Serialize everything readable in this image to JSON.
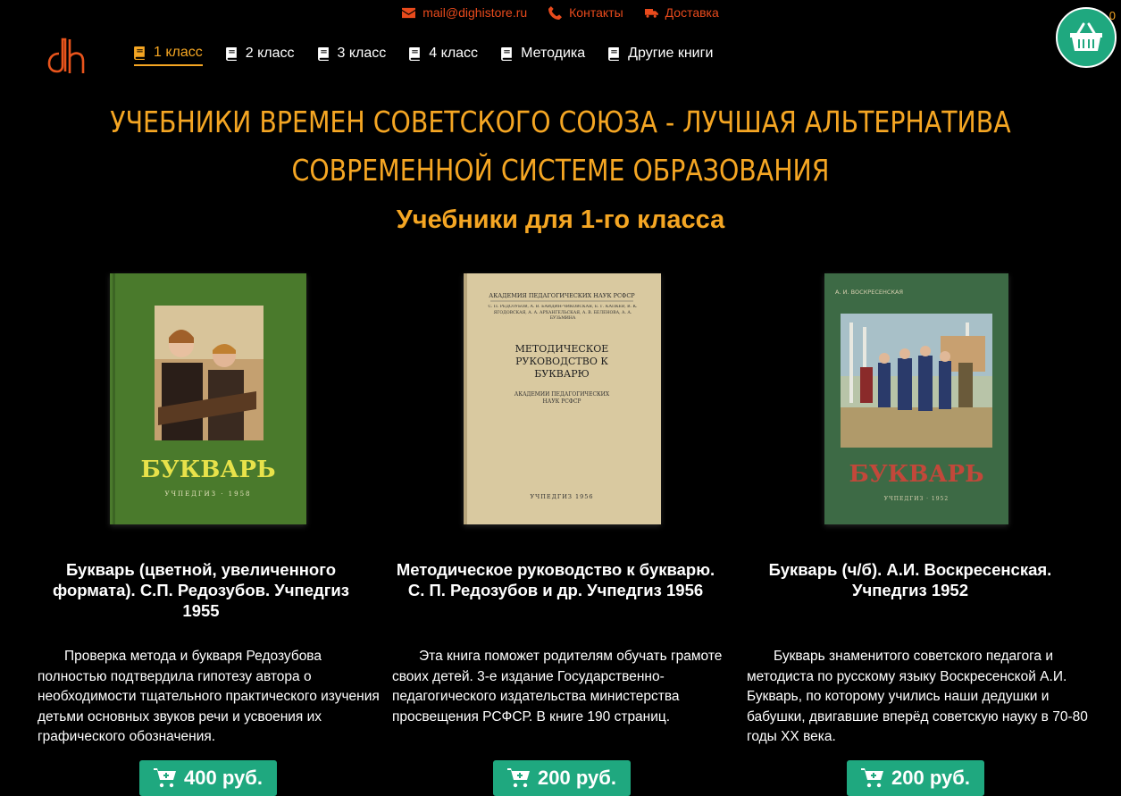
{
  "topbar": {
    "email": "mail@dighistore.ru",
    "contacts": "Контакты",
    "delivery": "Доставка"
  },
  "nav": {
    "items": [
      {
        "label": "1 класс",
        "active": true
      },
      {
        "label": "2 класс"
      },
      {
        "label": "3 класс"
      },
      {
        "label": "4 класс"
      },
      {
        "label": "Методика"
      },
      {
        "label": "Другие книги"
      }
    ]
  },
  "cart": {
    "count": "0"
  },
  "hero": {
    "line1": "УЧЕБНИКИ ВРЕМЕН СОВЕТСКОГО СОЮЗА - ЛУЧШАЯ АЛЬТЕРНАТИВА",
    "line2": "СОВРЕМЕННОЙ СИСТЕМЕ ОБРАЗОВАНИЯ"
  },
  "subtitle": "Учебники для 1-го класса",
  "products": [
    {
      "title": "Букварь (цветной, увеличенного формата). С.П. Редозубов. Учпедгиз 1955",
      "description": "Проверка метода и букваря Редозубова полностью подтвердила гипотезу автора о необходимости тщательного практического изучения детьми основных звуков речи и усвоения их графического обозначения.",
      "price": "400 руб.",
      "cover": {
        "title": "БУКВАРЬ",
        "publisher": "УЧПЕДГИЗ · 1958",
        "bg": "#4a7a2c",
        "title_color": "#e8e24a"
      }
    },
    {
      "title": "Методическое руководство к букварю. С. П. Редозубов и др. Учпедгиз 1956",
      "description": "Эта книга поможет родителям обучать грамоте своих детей. 3-е издание Государственно-педагогического издательства министерства просвещения РСФСР. В книге 190 страниц.",
      "price": "200 руб.",
      "cover": {
        "academy": "АКАДЕМИЯ ПЕДАГОГИЧЕСКИХ НАУК РСФСР",
        "authors": "С. П. РЕДОЗУБОВ, А. В. БАЙДИН-ЧИКОВСКАЯ, Е. Г. КАПКЕВ, В. К. ЯГОДОВСКАЯ, А. А. АРХАНГЕЛЬСКАЯ, А. В. БЕЛЕНОВА, А. А. БУЗЬМИНА",
        "title": "МЕТОДИЧЕСКОЕ РУКОВОДСТВО К БУКВАРЮ",
        "subtitle": "АКАДЕМИИ ПЕДАГОГИЧЕСКИХ НАУК РСФСР",
        "publisher": "УЧПЕДГИЗ 1956",
        "bg": "#d9c9a0"
      }
    },
    {
      "title": "Букварь (ч/б). А.И. Воскресенская. Учпедгиз 1952",
      "description": "Букварь знаменитого советского педагога и методиста по русскому языку Воскресенской А.И. Букварь, по которому учились наши дедушки и бабушки, двигавшие вперёд советскую науку в 70-80 годы XX века.",
      "price": "200 руб.",
      "cover": {
        "author": "А. И. ВОСКРЕСЕНСКАЯ",
        "title": "БУКВАРЬ",
        "publisher": "УЧПЕДГИЗ · 1952",
        "bg": "#3d6a45",
        "title_color": "#c2483a"
      }
    }
  ],
  "colors": {
    "accent": "#f5a623",
    "topbar": "#e84a1c",
    "green": "#1fa87f",
    "background": "#000000"
  }
}
